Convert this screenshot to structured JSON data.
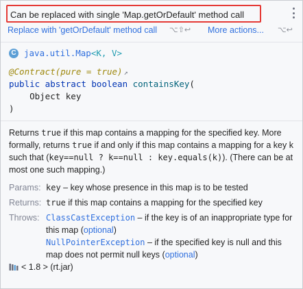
{
  "inspection": {
    "message": "Can be replaced with single 'Map.getOrDefault' method call",
    "actions": [
      {
        "label": "Replace with 'getOrDefault' method call",
        "shortcut": "⌥⇧↩"
      },
      {
        "label": "More actions...",
        "shortcut": "⌥↩"
      }
    ],
    "menu_icon": "kebab-menu-icon"
  },
  "definition": {
    "class_icon": "class-c-icon",
    "class_letter": "C",
    "class_name": "java.util.Map",
    "generics": "<K, V>",
    "annotation": "@Contract(pure = true)",
    "external_icon": "↗",
    "signature_kw": "public abstract boolean ",
    "method_name": "containsKey",
    "open_paren": "(",
    "param": "    Object key",
    "close_paren": ")"
  },
  "doc": {
    "desc_1": "Returns ",
    "desc_true_1": "true",
    "desc_2": " if this map contains a mapping for the specified key. More formally, returns ",
    "desc_true_2": "true",
    "desc_3": " if and only if this map contains a mapping for a key k such that (",
    "desc_code": "key==null ? k==null : key.equals(k)",
    "desc_4": "). (There can be at most one such mapping.)",
    "params_label": "Params:",
    "params_name": "key",
    "params_text": " – key whose presence in this map is to be tested",
    "returns_label": "Returns:",
    "returns_true": "true",
    "returns_text": " if this map contains a mapping for the specified key",
    "throws_label": "Throws:",
    "throws": [
      {
        "name": "ClassCastException",
        "text_1": " – if the key is of an inappropriate type for this map (",
        "link": "optional",
        "text_2": ")"
      },
      {
        "name": "NullPointerException",
        "text_1": " – if the specified key is null and this map does not permit null keys (",
        "link": "optional",
        "text_2": ")"
      }
    ]
  },
  "footer": {
    "icon": "library-jar-icon",
    "text": "< 1.8 > (rt.jar)"
  },
  "colors": {
    "highlight_border": "#e53935",
    "link": "#2f6fde",
    "keyword": "#0033b3",
    "annotation": "#9e880d",
    "method": "#00627a"
  }
}
